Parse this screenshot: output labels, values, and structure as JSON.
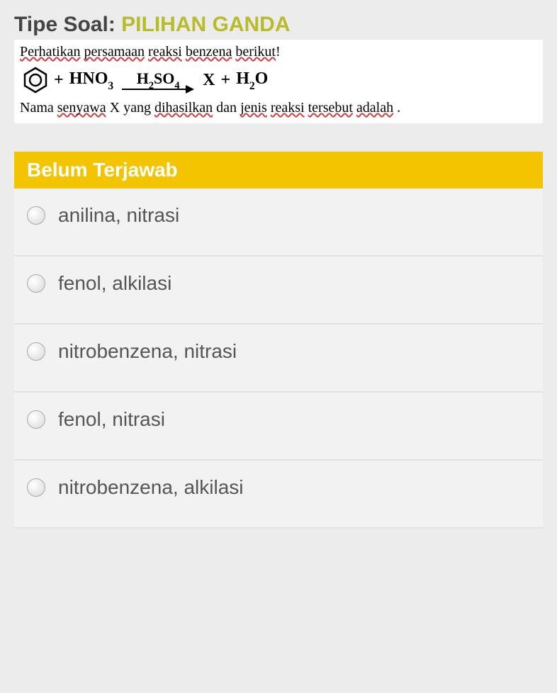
{
  "header": {
    "label": "Tipe Soal:",
    "qtype": "PILIHAN GANDA"
  },
  "question": {
    "line1_a": "Perhatikan",
    "line1_b": "persamaan",
    "line1_c": "reaksi",
    "line1_d": "benzena",
    "line1_e": "berikut",
    "line1_end": "!",
    "reaction": {
      "reagent1": "HNO",
      "reagent1_sub": "3",
      "catalyst_h": "H",
      "catalyst_sub1": "2",
      "catalyst_so": "SO",
      "catalyst_sub2": "4",
      "product_x": "X",
      "plus": "+",
      "product_h": "H",
      "product_sub1": "2",
      "product_o": "O"
    },
    "line2_a": "Nama",
    "line2_b": "senyawa",
    "line2_c": "X yang",
    "line2_d": "dihasilkan",
    "line2_e": "dan",
    "line2_f": "jenis",
    "line2_g": "reaksi",
    "line2_h": "tersebut",
    "line2_i": "adalah",
    "line2_end": " ."
  },
  "status": "Belum Terjawab",
  "options": [
    {
      "text": "anilina, nitrasi"
    },
    {
      "text": "fenol, alkilasi"
    },
    {
      "text": "nitrobenzena, nitrasi"
    },
    {
      "text": "fenol, nitrasi"
    },
    {
      "text": "nitrobenzena, alkilasi"
    }
  ]
}
